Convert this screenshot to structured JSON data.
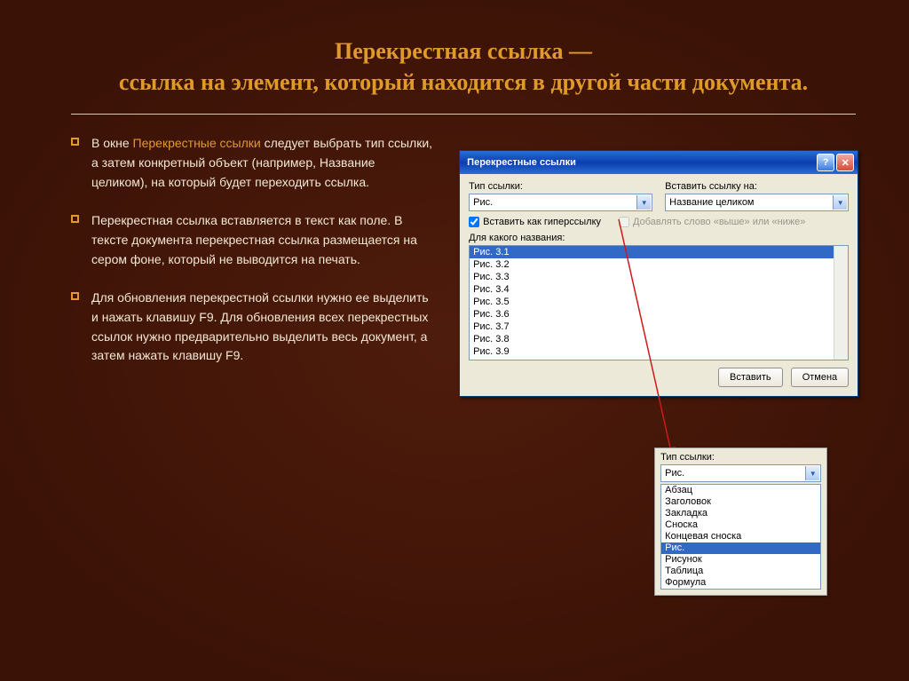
{
  "title": {
    "line1": "Перекрестная ссылка —",
    "line2": "ссылка на элемент, который находится в другой части документа."
  },
  "bullets": {
    "b1_pre": "В окне ",
    "b1_em": "Перекрестные ссылки",
    "b1_post": " следует выбрать тип ссылки, а затем конкретный объект (например, Название целиком), на который будет переходить ссылка.",
    "b2": "Перекрестная ссылка вставляется в текст как поле. В тексте документа перекрестная ссылка размещается на сером фоне, который не выводится на печать.",
    "b3": "Для обновления перекрестной ссылки нужно ее выделить и нажать клавишу F9. Для обновления всех перекрестных ссылок нужно предварительно выделить весь документ, а затем нажать клавишу F9."
  },
  "dialog": {
    "title": "Перекрестные ссылки",
    "label_type": "Тип ссылки:",
    "label_insert_on": "Вставить ссылку на:",
    "combo_type_value": "Рис.",
    "combo_insert_value": "Название целиком",
    "chk_hyperlink": "Вставить как гиперссылку",
    "chk_aboveBelow": "Добавлять слово «выше» или «ниже»",
    "label_which": "Для какого названия:",
    "list_items": [
      "Рис. 3.1",
      "Рис. 3.2",
      "Рис. 3.3",
      "Рис. 3.4",
      "Рис. 3.5",
      "Рис. 3.6",
      "Рис. 3.7",
      "Рис. 3.8",
      "Рис. 3.9"
    ],
    "btn_insert": "Вставить",
    "btn_cancel": "Отмена"
  },
  "dropdown": {
    "label": "Тип ссылки:",
    "value": "Рис.",
    "items": [
      "Абзац",
      "Заголовок",
      "Закладка",
      "Сноска",
      "Концевая сноска",
      "Рис.",
      "Рисунок",
      "Таблица",
      "Формула"
    ]
  }
}
